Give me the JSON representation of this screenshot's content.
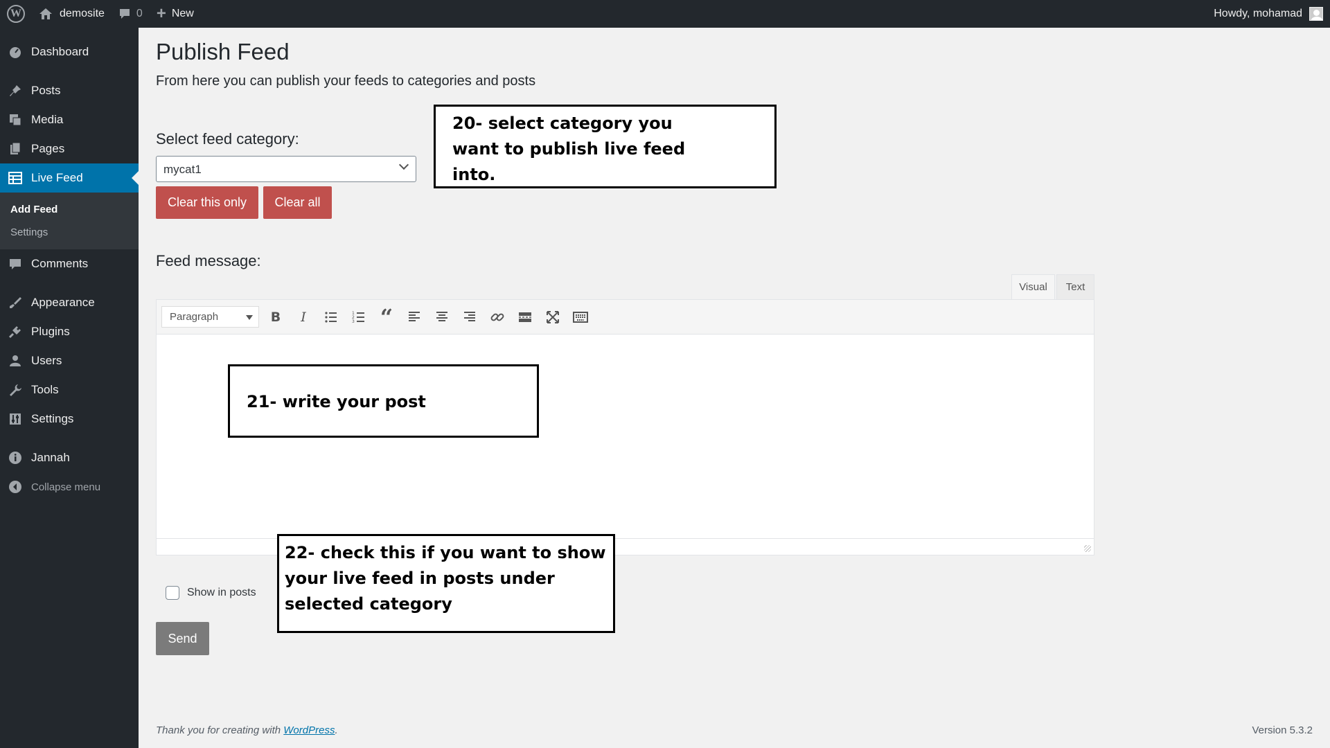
{
  "adminbar": {
    "site_name": "demosite",
    "comments_count": "0",
    "new_label": "New",
    "greeting": "Howdy, mohamad"
  },
  "sidebar": {
    "items": [
      {
        "label": "Dashboard",
        "icon": "dashboard-icon"
      },
      {
        "label": "Posts",
        "icon": "pin-icon"
      },
      {
        "label": "Media",
        "icon": "media-icon"
      },
      {
        "label": "Pages",
        "icon": "pages-icon"
      },
      {
        "label": "Live Feed",
        "icon": "table-icon",
        "active": true
      },
      {
        "label": "Comments",
        "icon": "comment-icon"
      },
      {
        "label": "Appearance",
        "icon": "brush-icon"
      },
      {
        "label": "Plugins",
        "icon": "plug-icon"
      },
      {
        "label": "Users",
        "icon": "user-icon"
      },
      {
        "label": "Tools",
        "icon": "wrench-icon"
      },
      {
        "label": "Settings",
        "icon": "sliders-icon"
      },
      {
        "label": "Jannah",
        "icon": "info-icon"
      }
    ],
    "submenu": [
      "Add Feed",
      "Settings"
    ],
    "collapse_label": "Collapse menu"
  },
  "main": {
    "title": "Publish Feed",
    "description": "From here you can publish your feeds to categories and posts",
    "category_label": "Select feed category:",
    "category_value": "mycat1",
    "clear_this_only": "Clear this only",
    "clear_all": "Clear all",
    "feed_message_label": "Feed message:",
    "tab_visual": "Visual",
    "tab_text": "Text",
    "format_select": "Paragraph",
    "show_in_posts": "Show in posts",
    "send": "Send"
  },
  "callouts": {
    "c20": [
      "20- select category you",
      "want to publish live feed",
      "into."
    ],
    "c21": [
      "21- write your post"
    ],
    "c22": [
      "22- check this if you want to show",
      "your live feed in posts under",
      "selected category"
    ]
  },
  "footer": {
    "thanks_prefix": "Thank you for creating with ",
    "thanks_link": "WordPress",
    "thanks_suffix": ".",
    "version": "Version 5.3.2"
  },
  "colors": {
    "admin_bg": "#23282d",
    "active_menu": "#0073aa",
    "red_button": "#c0504d",
    "send_button": "#7b7b7b"
  }
}
